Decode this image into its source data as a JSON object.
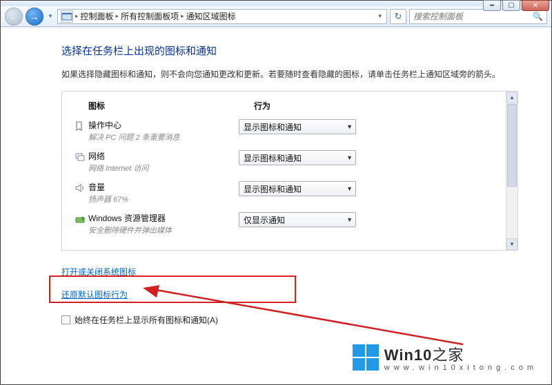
{
  "window": {
    "min_tip": "最小化",
    "max_tip": "还原",
    "close_tip": "关闭"
  },
  "nav": {
    "back_glyph": "←",
    "fwd_glyph": "→",
    "drop_glyph": "▾"
  },
  "address": {
    "crumbs": [
      "控制面板",
      "所有控制面板项",
      "通知区域图标"
    ],
    "sep": "▸",
    "drop": "▾",
    "refresh": "↻"
  },
  "search": {
    "placeholder": "搜索控制面板",
    "icon": "🔍"
  },
  "help": {
    "glyph": "?"
  },
  "page": {
    "title": "选择在任务栏上出现的图标和通知",
    "desc": "如果选择隐藏图标和通知，则不会向您通知更改和更新。若要随时查看隐藏的图标，请单击任务栏上通知区域旁的箭头。"
  },
  "columns": {
    "icon": "图标",
    "behavior": "行为"
  },
  "rows": [
    {
      "name": "操作中心",
      "desc": "解决 PC 问题  2 条重要消息",
      "value": "显示图标和通知"
    },
    {
      "name": "网络",
      "desc": "网络 Internet 访问",
      "value": "显示图标和通知"
    },
    {
      "name": "音量",
      "desc": "扬声器 67%",
      "value": "显示图标和通知"
    },
    {
      "name": "Windows 资源管理器",
      "desc": "安全删除硬件并弹出媒体",
      "value": "仅显示通知"
    }
  ],
  "links": {
    "toggle_system_icons": "打开或关闭系统图标",
    "restore_defaults": "还原默认图标行为"
  },
  "checkbox": {
    "label": "始终在任务栏上显示所有图标和通知(A)"
  },
  "watermark": {
    "brand_a": "Win10",
    "brand_b": "之家",
    "url": "www.win10xitong.com"
  }
}
